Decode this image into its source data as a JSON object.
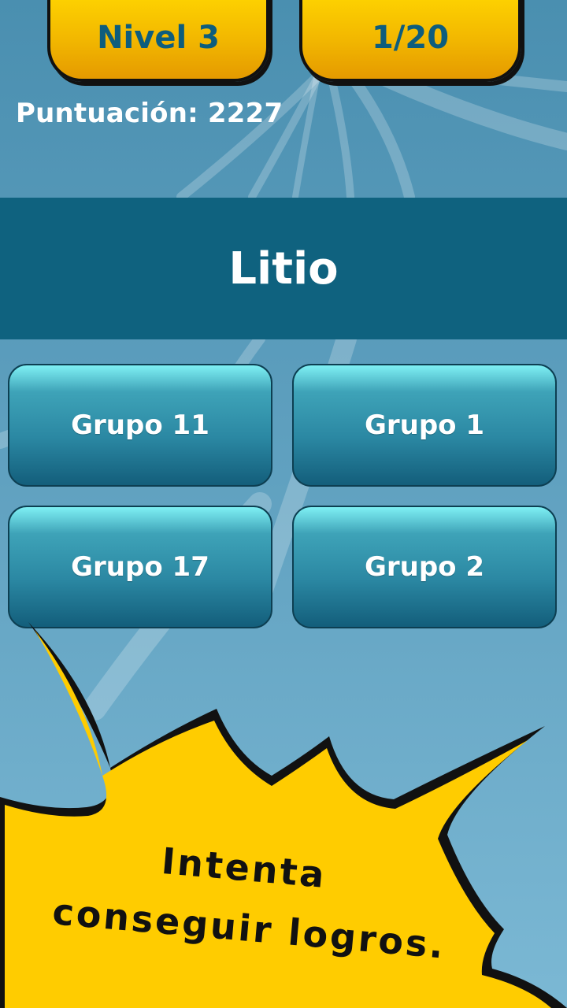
{
  "header": {
    "level_label": "Nivel 3",
    "progress_label": "1/20",
    "score_label": "Puntuación: 2227"
  },
  "question": {
    "prompt": "Litio"
  },
  "answers": [
    {
      "label": "Grupo 11"
    },
    {
      "label": "Grupo 1"
    },
    {
      "label": "Grupo 17"
    },
    {
      "label": "Grupo 2"
    }
  ],
  "promo": {
    "line1": "Intenta",
    "line2": "conseguir logros."
  },
  "colors": {
    "tab_yellow": "#f2b700",
    "tab_text": "#0d5d7d",
    "question_band": "#0f627f",
    "burst_yellow": "#ffcc00",
    "background": "#5fa0bf"
  }
}
